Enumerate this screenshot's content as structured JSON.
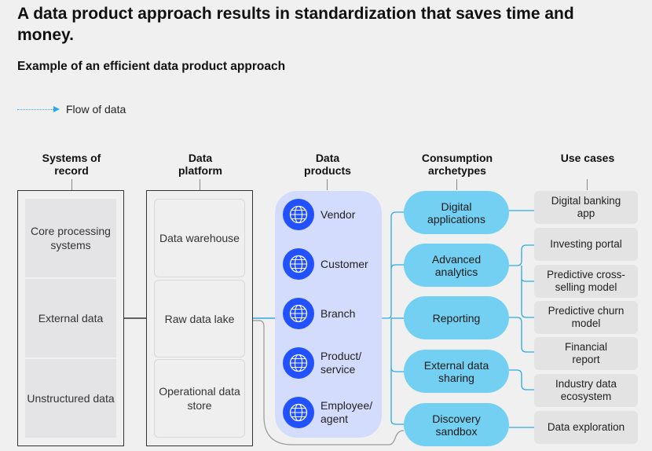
{
  "header": {
    "title": "A data product approach results in standardization that saves time and money.",
    "subtitle": "Example of an efficient data product approach"
  },
  "legend": {
    "label": "Flow of data",
    "icon": "dotted-arrow-icon",
    "color": "#2ea8e8"
  },
  "columns": {
    "systems_of_record": {
      "heading": "Systems of record",
      "items": [
        "Core processing systems",
        "External data",
        "Unstructured data"
      ]
    },
    "data_platform": {
      "heading": "Data platform",
      "items": [
        "Data warehouse",
        "Raw data lake",
        "Operational data store"
      ]
    },
    "data_products": {
      "heading": "Data products",
      "icon": "globe-icon",
      "items": [
        "Vendor",
        "Customer",
        "Branch",
        "Product/ service",
        "Employee/ agent"
      ]
    },
    "consumption_archetypes": {
      "heading": "Consumption archetypes",
      "items": [
        "Digital applications",
        "Advanced analytics",
        "Reporting",
        "External data sharing",
        "Discovery sandbox"
      ]
    },
    "use_cases": {
      "heading": "Use cases",
      "items": [
        "Digital banking app",
        "Investing portal",
        "Predictive cross-selling model",
        "Predictive churn model",
        "Financial report",
        "Industry data ecosystem",
        "Data exploration"
      ]
    }
  },
  "colors": {
    "product_panel": "#d4dcfd",
    "globe": "#2251ff",
    "archetype": "#73d0f2",
    "connector": "#2ea8e8",
    "use_case": "#e3e3e3"
  }
}
